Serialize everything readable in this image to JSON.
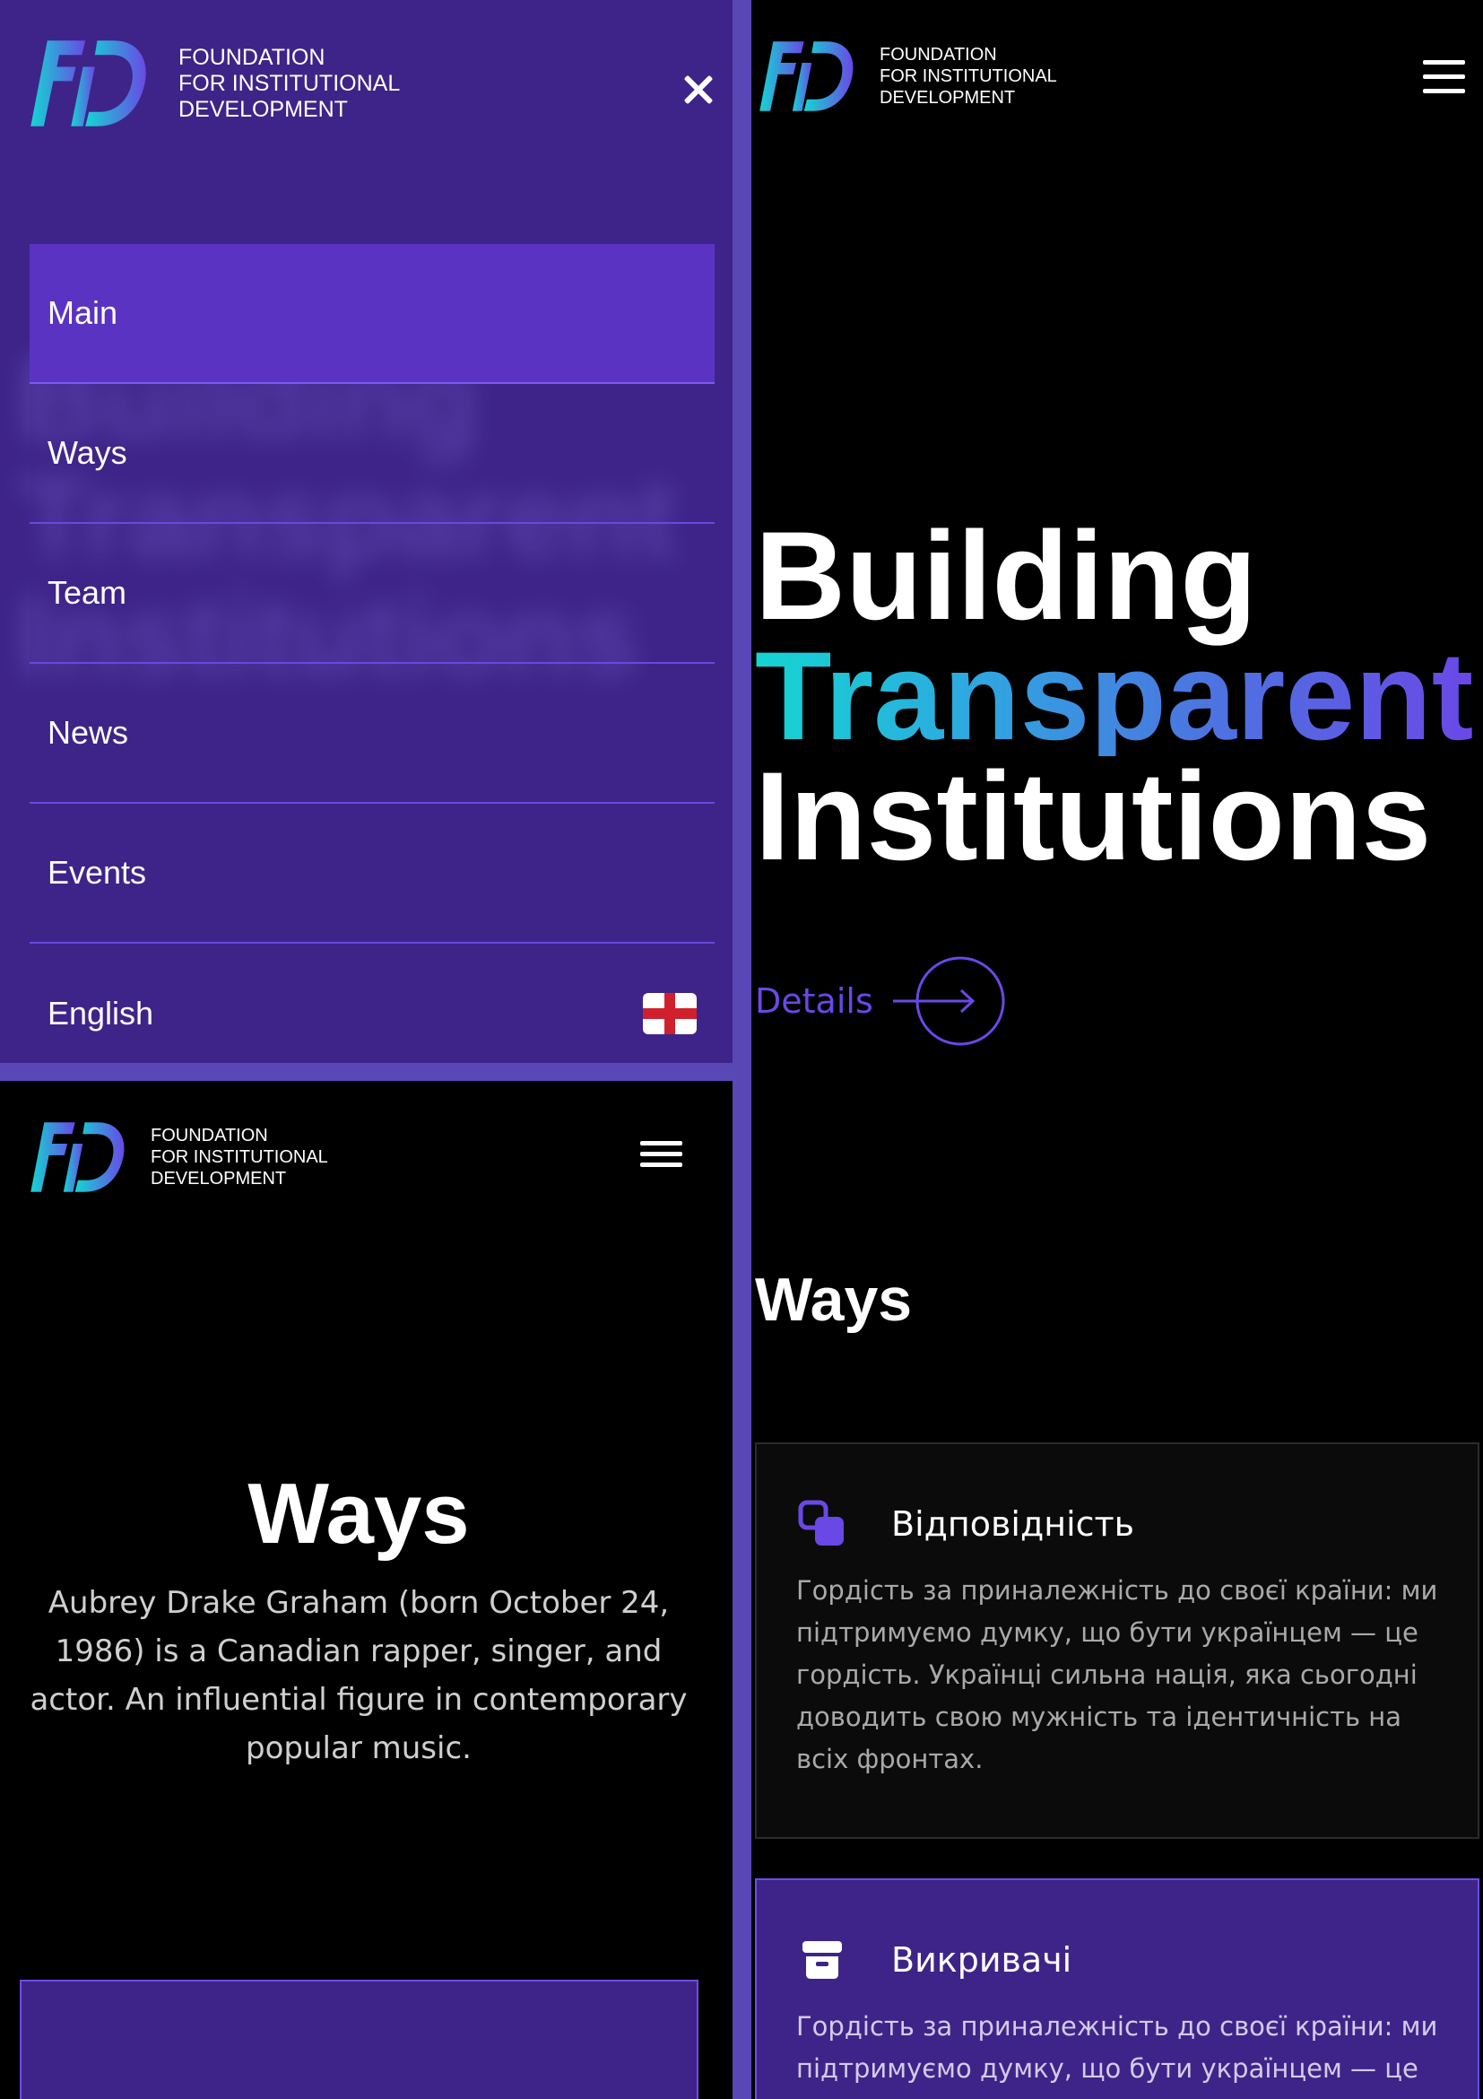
{
  "brand": {
    "line1": "FOUNDATION",
    "line2": "FOR INSTITUTIONAL",
    "line3": "DEVELOPMENT",
    "colors": {
      "mark_from": "#14d6d2",
      "mark_to": "#6a48e6",
      "accent": "#6a48e6",
      "menu_bg": "#3e2488"
    }
  },
  "menu": {
    "items": [
      {
        "label": "Main",
        "active": true
      },
      {
        "label": "Ways"
      },
      {
        "label": "Team"
      },
      {
        "label": "News"
      },
      {
        "label": "Events"
      }
    ],
    "language": {
      "label": "English",
      "flag": "england-flag-icon"
    }
  },
  "ways_mobile": {
    "title": "Ways",
    "description": "Aubrey Drake Graham (born October 24, 1986) is a Canadian rapper, singer, and actor. An influential figure in contemporary popular music."
  },
  "home": {
    "hero": {
      "line1": "Building",
      "line2": "Transparent",
      "line3": "Institutions"
    },
    "details_label": "Details",
    "ways_title": "Ways",
    "cards": [
      {
        "icon": "layers-icon",
        "title": "Відповідність",
        "text": "Гордість за приналежність до своєї країни: ми підтримуємо думку, що бути українцем — це гордість. Українці сильна нація, яка сьогодні доводить свою мужність та ідентичність на всіх фронтах."
      },
      {
        "icon": "archive-icon",
        "title": "Викривачі",
        "text": "Гордість за приналежність до своєї країни: ми підтримуємо думку, що бути українцем — це"
      }
    ]
  }
}
